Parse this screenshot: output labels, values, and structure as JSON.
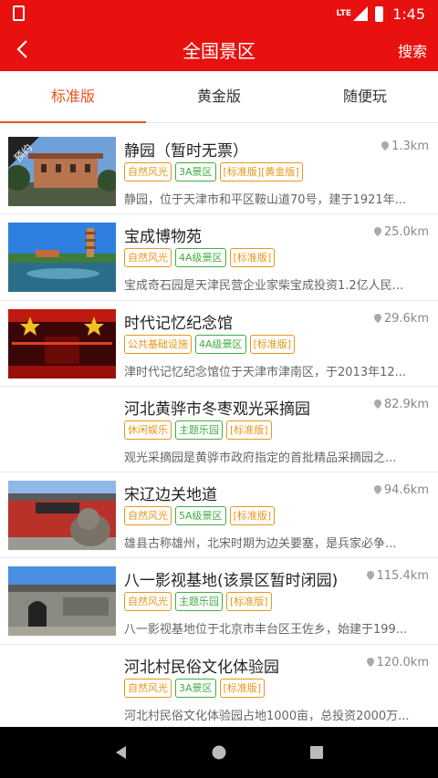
{
  "status": {
    "network": "LTE",
    "time": "1:45"
  },
  "header": {
    "title": "全国景区",
    "search_label": "搜索"
  },
  "tabs": [
    {
      "label": "标准版",
      "active": true
    },
    {
      "label": "黄金版",
      "active": false
    },
    {
      "label": "随便玩",
      "active": false
    }
  ],
  "items": [
    {
      "name": "静园（暂时无票）",
      "distance": "1.3km",
      "badge": "预约",
      "tags": [
        {
          "text": "自然风光",
          "color": "orange"
        },
        {
          "text": "3A景区",
          "color": "green"
        },
        {
          "text": "[标准版][黄金版]",
          "color": "orange"
        }
      ],
      "desc": "静园，位于天津市和平区鞍山道70号，建于1921年..."
    },
    {
      "name": "宝成博物苑",
      "distance": "25.0km",
      "tags": [
        {
          "text": "自然风光",
          "color": "orange"
        },
        {
          "text": "4A级景区",
          "color": "green"
        },
        {
          "text": "[标准版]",
          "color": "orange"
        }
      ],
      "desc": "宝成奇石园是天津民营企业家柴宝成投资1.2亿人民..."
    },
    {
      "name": "时代记忆纪念馆",
      "distance": "29.6km",
      "tags": [
        {
          "text": "公共基础设施",
          "color": "orange"
        },
        {
          "text": "4A级景区",
          "color": "green"
        },
        {
          "text": "[标准版]",
          "color": "orange"
        }
      ],
      "desc": "津时代记忆纪念馆位于天津市津南区，于2013年12..."
    },
    {
      "name": "河北黄骅市冬枣观光采摘园",
      "distance": "82.9km",
      "tags": [
        {
          "text": "休闲娱乐",
          "color": "orange"
        },
        {
          "text": "主题乐园",
          "color": "green"
        },
        {
          "text": "[标准版]",
          "color": "orange"
        }
      ],
      "desc": "观光采摘园是黄骅市政府指定的首批精品采摘园之..."
    },
    {
      "name": "宋辽边关地道",
      "distance": "94.6km",
      "tags": [
        {
          "text": "自然风光",
          "color": "orange"
        },
        {
          "text": "5A级景区",
          "color": "green"
        },
        {
          "text": "[标准版]",
          "color": "orange"
        }
      ],
      "desc": "雄县古称雄州，北宋时期为边关要塞，是兵家必争..."
    },
    {
      "name": "八一影视基地(该景区暂时闭园)",
      "distance": "115.4km",
      "tags": [
        {
          "text": "自然风光",
          "color": "orange"
        },
        {
          "text": "主题乐园",
          "color": "green"
        },
        {
          "text": "[标准版]",
          "color": "orange"
        }
      ],
      "desc": "八一影视基地位于北京市丰台区王佐乡，始建于199..."
    },
    {
      "name": "河北村民俗文化体验园",
      "distance": "120.0km",
      "tags": [
        {
          "text": "自然风光",
          "color": "orange"
        },
        {
          "text": "3A景区",
          "color": "green"
        },
        {
          "text": "[标准版]",
          "color": "orange"
        }
      ],
      "desc": "河北村民俗文化体验园占地1000亩，总投资2000万..."
    }
  ]
}
